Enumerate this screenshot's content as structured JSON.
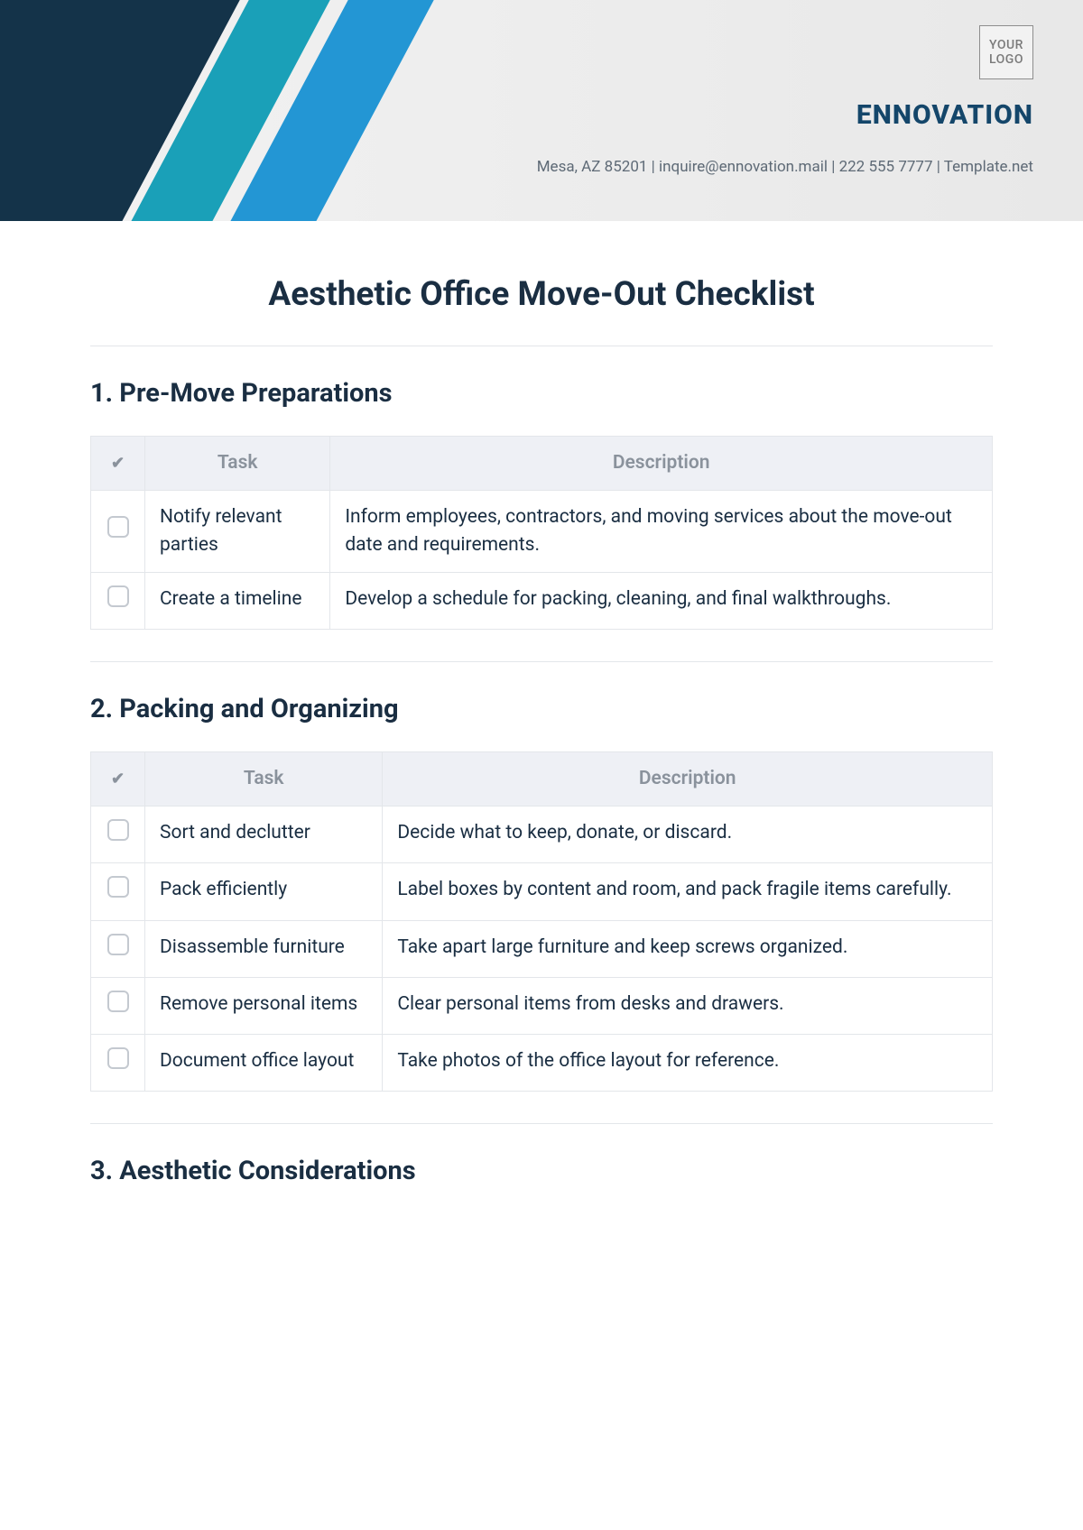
{
  "header": {
    "logo_text": "YOUR\nLOGO",
    "brand": "ENNOVATION",
    "contact": "Mesa, AZ 85201 | inquire@ennovation.mail | 222 555 7777 | Template.net"
  },
  "title": "Aesthetic Office Move-Out Checklist",
  "columns": {
    "check": "✔",
    "task": "Task",
    "desc": "Description"
  },
  "sections": [
    {
      "heading": "1. Pre-Move Preparations",
      "rows": [
        {
          "task": "Notify relevant parties",
          "desc": "Inform employees, contractors, and moving services about the move-out date and requirements."
        },
        {
          "task": "Create a timeline",
          "desc": "Develop a schedule for packing, cleaning, and final walkthroughs."
        }
      ]
    },
    {
      "heading": "2. Packing and Organizing",
      "rows": [
        {
          "task": "Sort and declutter",
          "desc": "Decide what to keep, donate, or discard."
        },
        {
          "task": "Pack efficiently",
          "desc": "Label boxes by content and room, and pack fragile items carefully."
        },
        {
          "task": "Disassemble furniture",
          "desc": "Take apart large furniture and keep screws organized."
        },
        {
          "task": "Remove personal items",
          "desc": "Clear personal items from desks and drawers."
        },
        {
          "task": "Document office layout",
          "desc": "Take photos of the office layout for reference."
        }
      ]
    },
    {
      "heading": "3. Aesthetic Considerations",
      "rows": []
    }
  ]
}
